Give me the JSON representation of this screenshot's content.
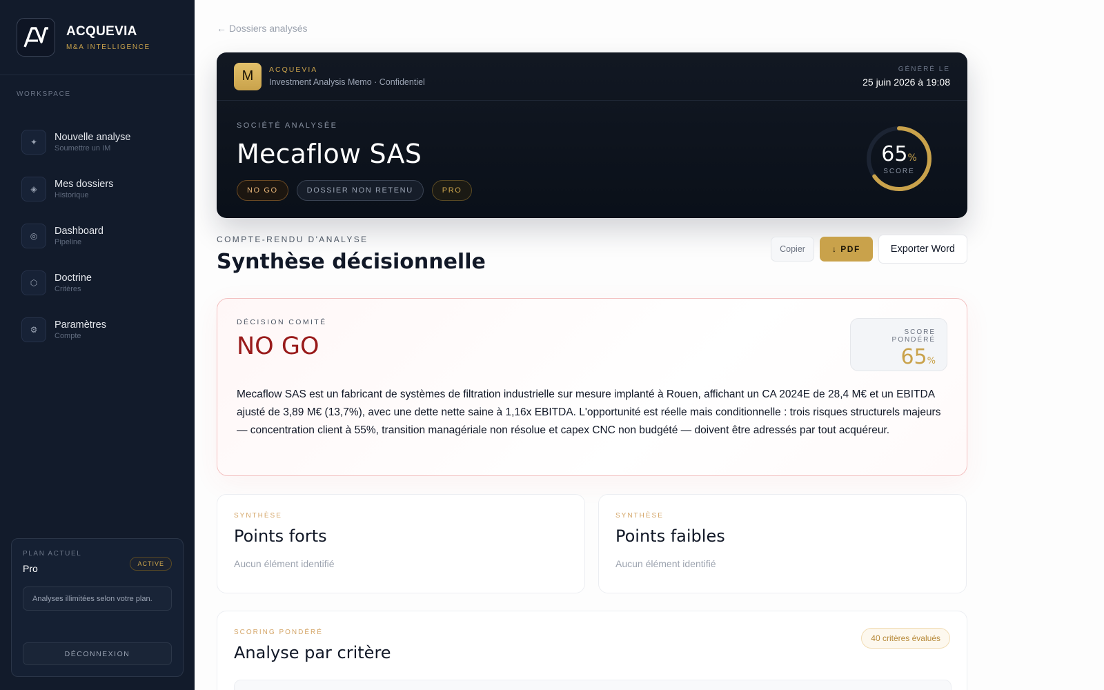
{
  "brand": {
    "name": "ACQUEVIA",
    "subtitle": "M&A INTELLIGENCE"
  },
  "sidebar": {
    "section_label": "WORKSPACE",
    "items": [
      {
        "title": "Nouvelle analyse",
        "subtitle": "Soumettre un IM",
        "icon": "sparkle-icon"
      },
      {
        "title": "Mes dossiers",
        "subtitle": "Historique",
        "icon": "diamond-icon"
      },
      {
        "title": "Dashboard",
        "subtitle": "Pipeline",
        "icon": "target-icon"
      },
      {
        "title": "Doctrine",
        "subtitle": "Critères",
        "icon": "hexagon-icon"
      },
      {
        "title": "Paramètres",
        "subtitle": "Compte",
        "icon": "gear-icon"
      }
    ],
    "plan": {
      "label": "PLAN ACTUEL",
      "name": "Pro",
      "status": "ACTIVE",
      "info": "Analyses illimitées selon votre plan.",
      "logout": "DÉCONNEXION"
    }
  },
  "main": {
    "back_link": "← Dossiers analysés",
    "hero": {
      "logo_letter": "M",
      "brand": "ACQUEVIA",
      "memo": "Investment Analysis Memo · Confidentiel",
      "generated_label": "GÉNÉRÉ LE",
      "generated_date": "25 juin 2026 à 19:08",
      "company_label": "SOCIÉTÉ ANALYSÉE",
      "company": "Mecaflow SAS",
      "tags": [
        "NO GO",
        "DOSSIER NON RETENU",
        "PRO"
      ],
      "score": "65",
      "score_unit": "%",
      "score_label": "SCORE",
      "score_fraction": 0.65
    },
    "section_label": "COMPTE-RENDU D'ANALYSE",
    "section_title": "Synthèse décisionnelle",
    "actions": {
      "copy": "Copier",
      "pdf": "↓ PDF",
      "word": "Exporter Word"
    },
    "decision": {
      "label": "DÉCISION COMITÉ",
      "value": "NO GO",
      "score_label": "SCORE PONDÉRÉ",
      "score": "65",
      "score_unit": "%",
      "text": "Mecaflow SAS est un fabricant de systèmes de filtration industrielle sur mesure implanté à Rouen, affichant un CA 2024E de 28,4 M€ et un EBITDA ajusté de 3,89 M€ (13,7%), avec une dette nette saine à 1,16x EBITDA. L'opportunité est réelle mais conditionnelle : trois risques structurels majeurs — concentration client à 55%, transition managériale non résolue et capex CNC non budgété — doivent être adressés par tout acquéreur."
    },
    "strengths": {
      "label": "SYNTHÈSE",
      "title": "Points forts",
      "empty": "Aucun élément identifié"
    },
    "weaknesses": {
      "label": "SYNTHÈSE",
      "title": "Points faibles",
      "empty": "Aucun élément identifié"
    },
    "criteria": {
      "label": "SCORING PONDÉRÉ",
      "title": "Analyse par critère",
      "badge": "40 critères évalués"
    }
  },
  "colors": {
    "sidebar_bg": "#121b2b",
    "gold": "#c9a24b",
    "nogo_red": "#991b1b"
  }
}
